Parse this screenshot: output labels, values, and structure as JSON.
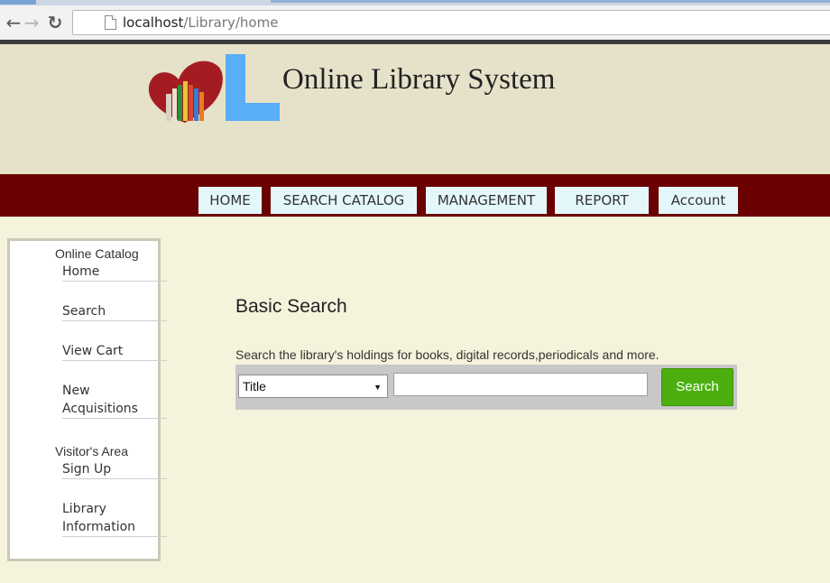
{
  "browser": {
    "url_host": "localhost",
    "url_path": "/Library/home"
  },
  "header": {
    "title": "Online Library System"
  },
  "nav": {
    "items": [
      "HOME",
      "SEARCH CATALOG",
      "MANAGEMENT",
      "REPORT",
      "Account"
    ]
  },
  "sidebar": {
    "online_catalog_heading": "Online Catalog",
    "home": "Home",
    "search": "Search",
    "view_cart": "View Cart",
    "new_acquisitions_1": "New",
    "new_acquisitions_2": "Acquisitions",
    "visitors_heading": "Visitor's Area",
    "sign_up": "Sign Up",
    "library_information_1": "Library",
    "library_information_2": "Information"
  },
  "search": {
    "heading": "Basic Search",
    "description": "Search the library's holdings for books, digital records,periodicals and more.",
    "field_selected": "Title",
    "query_value": "",
    "button_label": "Search"
  },
  "colors": {
    "header_bg": "#e6e1c9",
    "nav_bg": "#6b0000",
    "nav_item_bg": "#e4f7fb",
    "content_bg": "#f5f3dc",
    "search_button": "#4caf0f"
  }
}
